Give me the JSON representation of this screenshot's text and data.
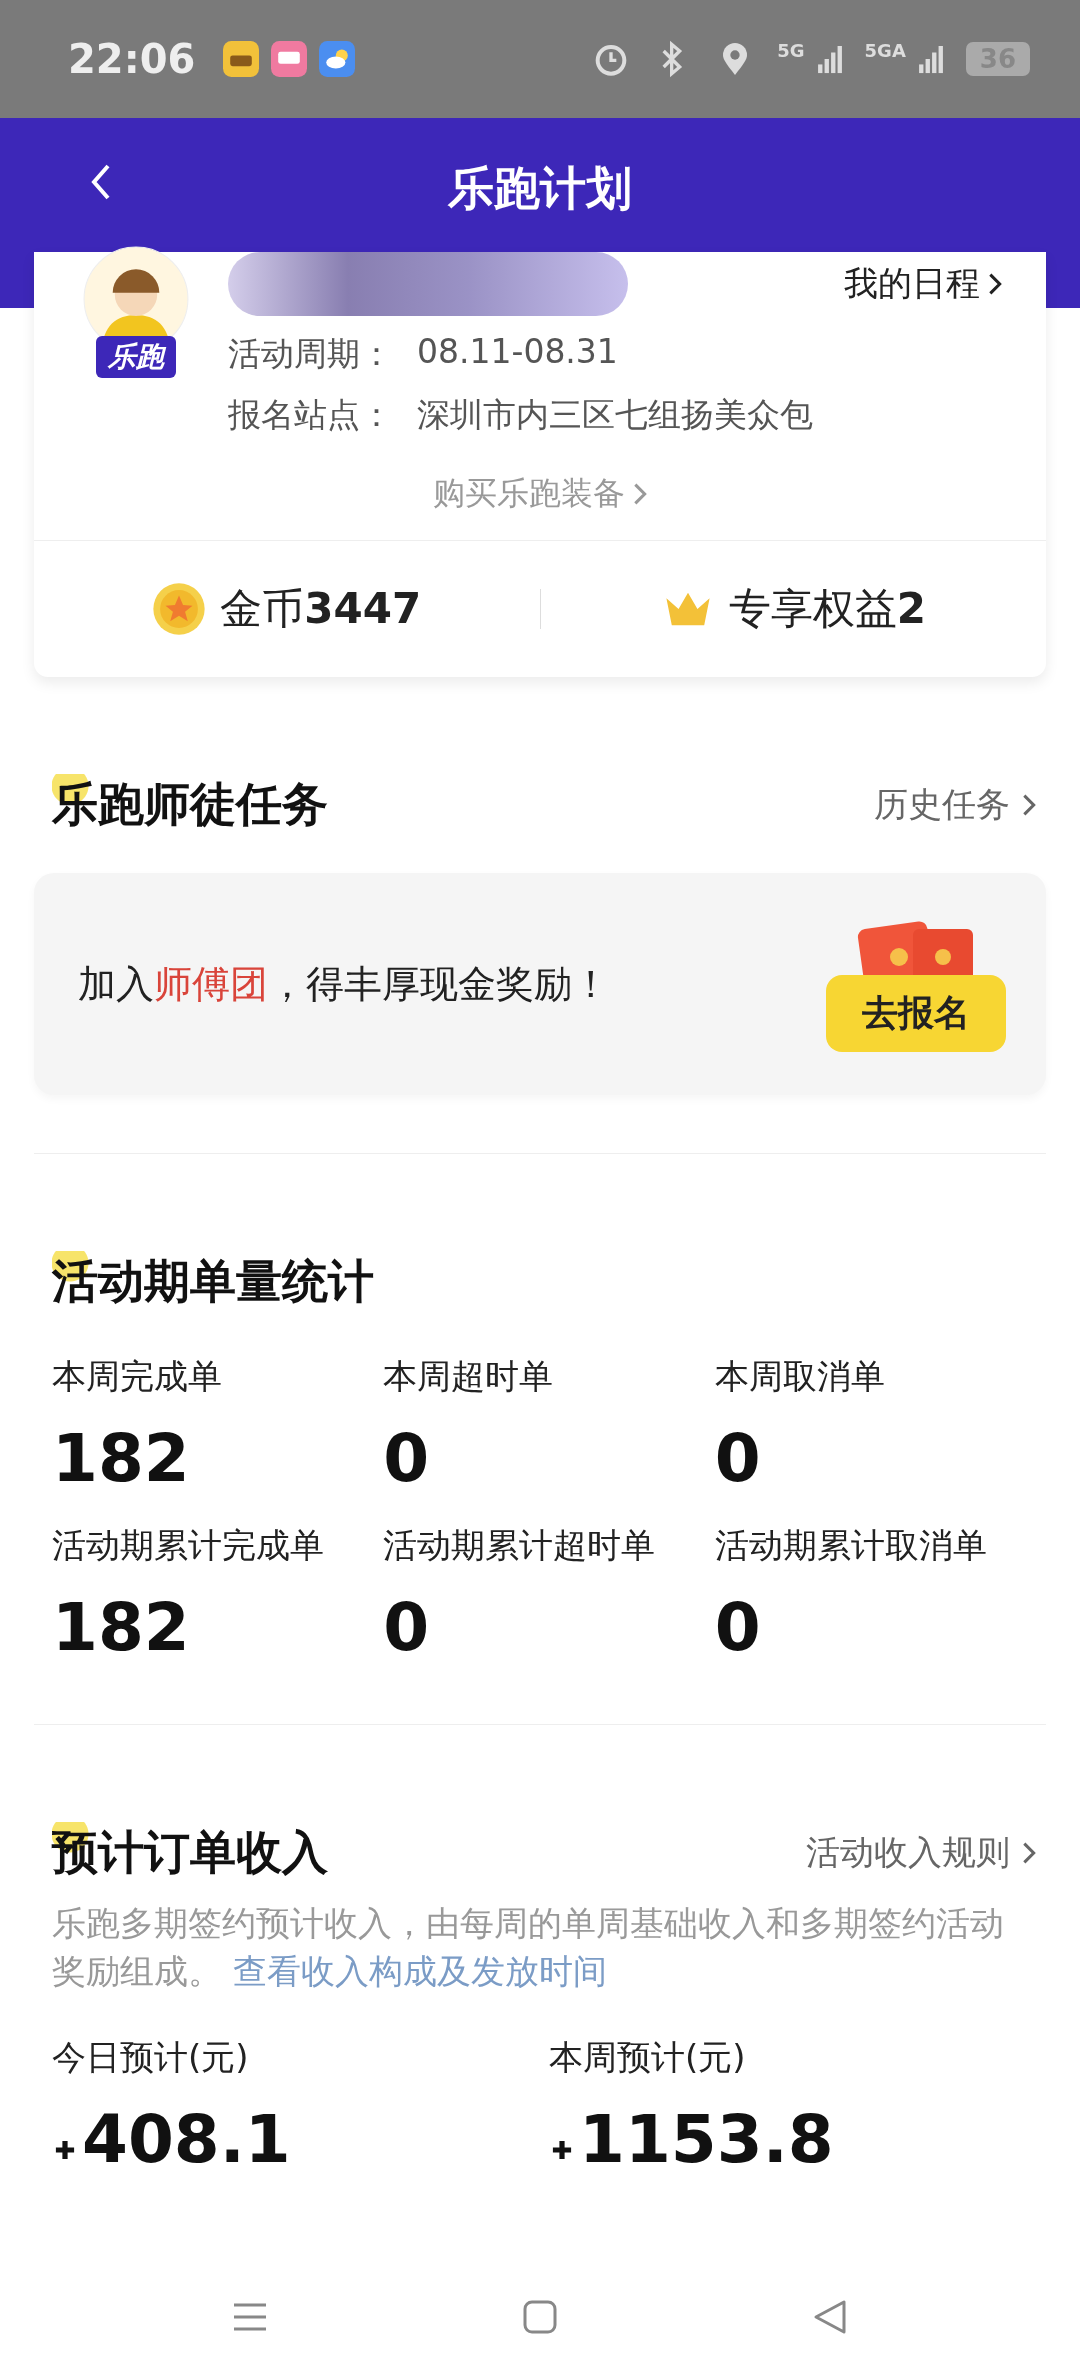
{
  "status_bar": {
    "time": "22:06",
    "network_1": "5G",
    "network_2": "5GA",
    "battery": "36"
  },
  "header": {
    "title": "乐跑计划"
  },
  "profile": {
    "badge": "乐跑",
    "schedule_link": "我的日程",
    "fields": [
      {
        "label": "活动周期：",
        "value": "08.11-08.31"
      },
      {
        "label": "报名站点：",
        "value": "深圳市内三区七组扬美众包"
      }
    ],
    "gear_link": "购买乐跑装备",
    "coins": {
      "label": "金币",
      "value": "3447"
    },
    "perks": {
      "label": "专享权益",
      "value": "2"
    }
  },
  "mentor": {
    "title": "乐跑师徒任务",
    "history_link": "历史任务",
    "banner_text": "加入**师傅团**，得丰厚现金奖励！",
    "banner_button": "去报名"
  },
  "stats": {
    "title": "活动期单量统计",
    "items": [
      {
        "label": "本周完成单",
        "value": "182"
      },
      {
        "label": "本周超时单",
        "value": "0"
      },
      {
        "label": "本周取消单",
        "value": "0"
      },
      {
        "label": "活动期累计完成单",
        "value": "182"
      },
      {
        "label": "活动期累计超时单",
        "value": "0"
      },
      {
        "label": "活动期累计取消单",
        "value": "0"
      }
    ]
  },
  "income": {
    "title": "预计订单收入",
    "rules_link": "活动收入规则",
    "description": "乐跑多期签约预计收入，由每周的单周基础收入和多期签约活动奖励组成。",
    "detail_link": "查看收入构成及发放时间",
    "items": [
      {
        "label": "今日预计(元)",
        "value": "408.1"
      },
      {
        "label": "本周预计(元)",
        "value": "1153.8"
      }
    ]
  }
}
